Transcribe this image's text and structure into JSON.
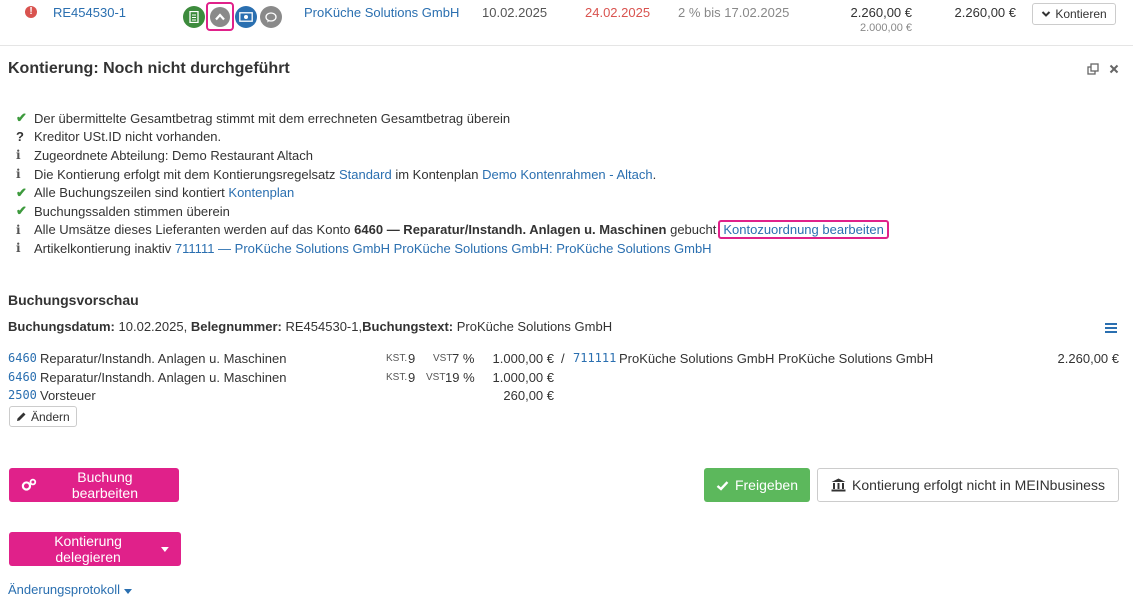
{
  "invoice": {
    "alert": "!",
    "number": "RE454530-1",
    "vendor": "ProKüche Solutions GmbH",
    "invoice_date": "10.02.2025",
    "due_date": "24.02.2025",
    "skonto": "2 % bis 17.02.2025",
    "gross_amount": "2.260,00 €",
    "net_amount": "2.000,00 €",
    "open_amount": "2.260,00 €",
    "kontieren_label": "Kontieren"
  },
  "kontierung": {
    "title": "Kontierung: Noch nicht durchgeführt",
    "checks": [
      {
        "mark": "✔",
        "type": "ok",
        "text": "Der übermittelte Gesamtbetrag stimmt mit dem errechneten Gesamtbetrag überein"
      },
      {
        "mark": "?",
        "type": "q",
        "text": "Kreditor USt.ID nicht vorhanden."
      },
      {
        "mark": "i",
        "type": "i",
        "text": "Zugeordnete Abteilung: Demo Restaurant Altach"
      },
      {
        "mark": "i",
        "type": "i",
        "pre": "Die Kontierung erfolgt mit dem Kontierungsregelsatz ",
        "link1": "Standard",
        "mid": " im Kontenplan ",
        "link2": "Demo Kontenrahmen - Altach",
        "post": "."
      },
      {
        "mark": "✔",
        "type": "ok",
        "pre": "Alle Buchungszeilen sind kontiert ",
        "link1": "Kontenplan"
      },
      {
        "mark": "✔",
        "type": "ok",
        "text": "Buchungssalden stimmen überein"
      },
      {
        "mark": "i",
        "type": "i",
        "pre": "Alle Umsätze dieses Lieferanten werden auf das Konto ",
        "bold": "6460 — Reparatur/Instandh. Anlagen u. Maschinen",
        "post": " gebucht",
        "link1": "Kontozuordnung bearbeiten"
      },
      {
        "mark": "i",
        "type": "i",
        "pre": "Artikelkontierung inaktiv ",
        "link1": "711111 — ProKüche Solutions GmbH ProKüche Solutions GmbH: ProKüche Solutions GmbH"
      }
    ]
  },
  "preview": {
    "title": "Buchungsvorschau",
    "date_label": "Buchungsdatum:",
    "date": "10.02.2025,",
    "beleg_label": "Belegnummer:",
    "beleg": "RE454530-1,",
    "text_label": "Buchungstext:",
    "text": "ProKüche Solutions GmbH",
    "rows": [
      {
        "account": "6460",
        "name": "Reparatur/Instandh. Anlagen u. Maschinen",
        "kst_label": "KST.",
        "kst": "9",
        "vst_label": "VST",
        "vst": "7 %",
        "amount": "1.000,00 €",
        "sep": "/",
        "contra_account": "711111",
        "contra_name": "ProKüche Solutions GmbH ProKüche Solutions GmbH",
        "total": "2.260,00 €"
      },
      {
        "account": "6460",
        "name": "Reparatur/Instandh. Anlagen u. Maschinen",
        "kst_label": "KST.",
        "kst": "9",
        "vst_label": "VST",
        "vst": "19 %",
        "amount": "1.000,00 €"
      },
      {
        "account": "2500",
        "name": "Vorsteuer",
        "amount": "260,00 €"
      }
    ],
    "aendern_label": "Ändern"
  },
  "actions": {
    "edit_label": "Buchung bearbeiten",
    "release_label": "Freigeben",
    "not_mein_label": "Kontierung erfolgt nicht in MEINbusiness",
    "delegate_label": "Kontierung delegieren",
    "protokoll_label": "Änderungsprotokoll"
  },
  "colors": {
    "accent": "#e0218a",
    "link": "#2a6fb0",
    "success": "#5cb85c",
    "danger": "#d9534f"
  }
}
